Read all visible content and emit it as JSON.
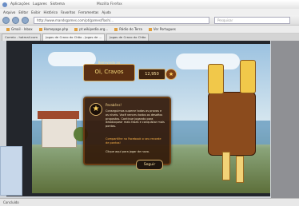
{
  "topPanel": {
    "items": [
      "Aplicações",
      "Lugares",
      "Sistema"
    ],
    "windowTitle": "Mozilla Firefox"
  },
  "browser": {
    "menu": [
      "Arquivo",
      "Editar",
      "Exibir",
      "Histórico",
      "Favoritos",
      "Ferramentas",
      "Ajuda"
    ],
    "url": "http://www.mandsgames.com/pt/games/flash/...",
    "search": "Pesquisar",
    "bookmarks": [
      "Gmail - Inbox",
      "Homepage.php",
      "pt.wikipedia.org...",
      "Rádio do Terra",
      "Ver Portugues"
    ],
    "tabs": [
      "Correio - hotmail.com",
      "Jogos de Cravo do Chão - Jogos de ...",
      "Jogos de Cravo do Chão"
    ]
  },
  "game": {
    "signTop": "Bem-vindo ao",
    "signTitle": "Oi, Cravos",
    "score": "12,950",
    "dialogTitle": "Parabéns!",
    "dialogText": "Conseguimos superar todas as provas e os níveis. Você venceu todos os desafios propostos. Continue jogando para desbloquear mais fases e conquistar mais pontos.",
    "dialogLink": "Compartilhe no Facebook o seu recorde de pontos!",
    "dialogNote": "Clique aqui para jogar de novo.",
    "buttonLabel": "Seguir"
  },
  "status": "Concluído"
}
